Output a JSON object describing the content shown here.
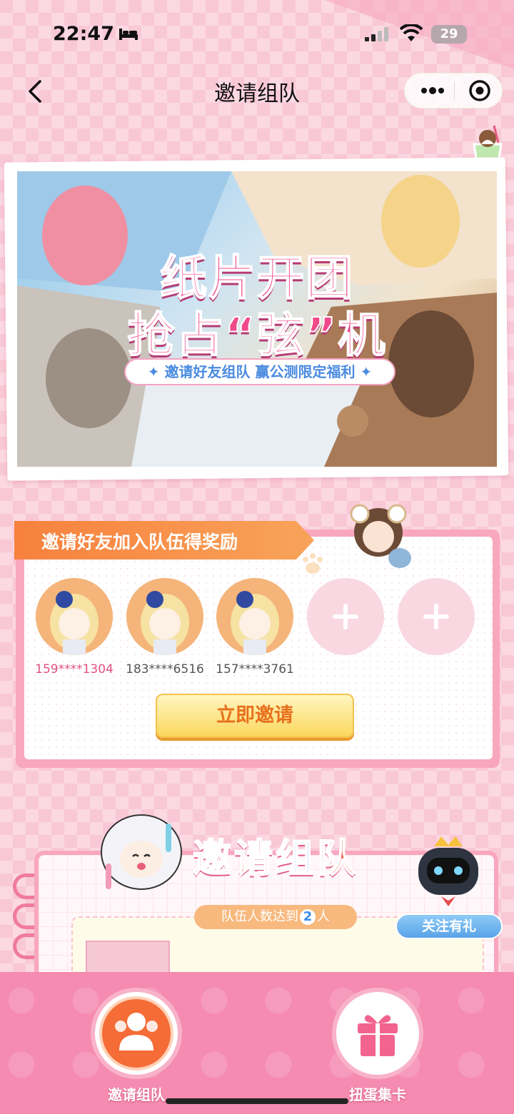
{
  "status_bar": {
    "time": "22:47",
    "battery": "29"
  },
  "nav": {
    "title": "邀请组队"
  },
  "banner": {
    "title_line1": "纸片开团",
    "title_line2": "抢占“弦”机",
    "subtitle": "✦ 邀请好友组队  赢公测限定福利 ✦"
  },
  "invite_card": {
    "header": "邀请好友加入队伍得奖励",
    "members": [
      {
        "name": "159****1304",
        "color": "#e2527f"
      },
      {
        "name": "183****6516",
        "color": "#555555"
      },
      {
        "name": "157****3761",
        "color": "#555555"
      }
    ],
    "empty_slots": 2,
    "invite_button": "立即邀请"
  },
  "team_section": {
    "title_part1": "邀请",
    "title_part2": "组",
    "title_part3": "队",
    "requirement_prefix": "队伍人数达到",
    "requirement_num": "2",
    "requirement_suffix": "人",
    "follow_badge": "关注有礼"
  },
  "tabbar": {
    "tabs": [
      {
        "label": "邀请组队",
        "icon": "team-icon"
      },
      {
        "label": "扭蛋集卡",
        "icon": "gift-icon"
      }
    ]
  },
  "colors": {
    "accent_pink": "#f58bb0",
    "accent_orange": "#f56c36",
    "blue": "#5aa4ec"
  }
}
